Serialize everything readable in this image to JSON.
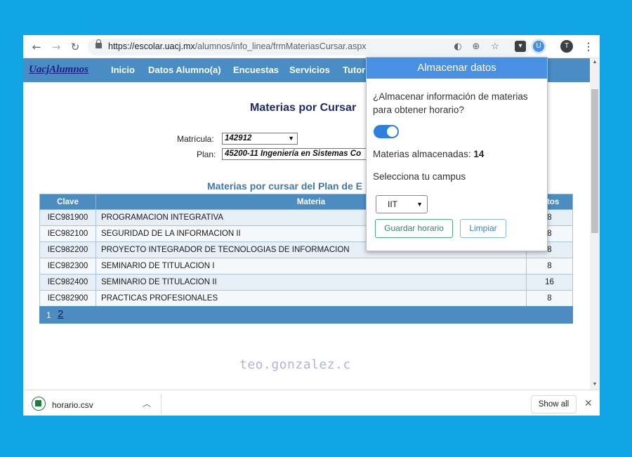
{
  "browser": {
    "url_host": "https://escolar.uacj.mx",
    "url_path": "/alumnos/info_linea/frmMateriasCursar.aspx",
    "profile_initial": "T"
  },
  "sitenav": {
    "brand": "UacjAlumnos",
    "links": [
      "Inicio",
      "Datos Alumno(a)",
      "Encuestas",
      "Servicios",
      "Tutor"
    ]
  },
  "page": {
    "title": "Materias por Cursar",
    "matricula_label": "Matrícula:",
    "matricula_value": "142912",
    "plan_label": "Plan:",
    "plan_value": "45200-11 Ingeniería en Sistemas Co",
    "section_title": "Materias por cursar del Plan de E",
    "table": {
      "headers": [
        "Clave",
        "Materia",
        "ditos"
      ],
      "rows": [
        {
          "clave": "IEC981900",
          "materia": "PROGRAMACION INTEGRATIVA",
          "creditos": "8"
        },
        {
          "clave": "IEC982100",
          "materia": "SEGURIDAD DE LA INFORMACION II",
          "creditos": "8"
        },
        {
          "clave": "IEC982200",
          "materia": "PROYECTO INTEGRADOR DE TECNOLOGIAS DE INFORMACION",
          "creditos": "8"
        },
        {
          "clave": "IEC982300",
          "materia": "SEMINARIO DE TITULACION I",
          "creditos": "8"
        },
        {
          "clave": "IEC982400",
          "materia": "SEMINARIO DE TITULACION II",
          "creditos": "16"
        },
        {
          "clave": "IEC982900",
          "materia": "PRACTICAS PROFESIONALES",
          "creditos": "8"
        }
      ]
    },
    "pager": {
      "current": "1",
      "next": "2"
    },
    "watermark": "teo.gonzalez.c"
  },
  "popup": {
    "title": "Almacenar datos",
    "question": "¿Almacenar información de materias para obtener horario?",
    "toggle_on": true,
    "stored_label": "Materias almacenadas:",
    "stored_count": "14",
    "campus_label": "Selecciona tu campus",
    "campus_value": "IIT",
    "save_button": "Guardar horario",
    "clear_button": "Limpiar"
  },
  "downloads": {
    "file_name": "horario.csv",
    "show_all": "Show all"
  },
  "colors": {
    "background": "#12a5e6",
    "nav_bar": "#4a8cc4",
    "popup_header": "#4a90e2",
    "toggle": "#2f7fde"
  }
}
